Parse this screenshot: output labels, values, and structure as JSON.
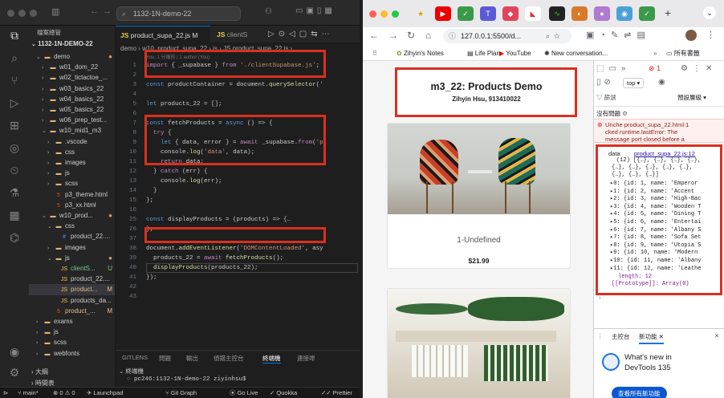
{
  "vscode": {
    "search": "1132-1N-demo-22",
    "explorer_title": "檔案總管",
    "explorer_root": "1132-1N-DEMO-22",
    "tree": [
      {
        "label": "demo",
        "icon": "folder",
        "open": true,
        "depth": 1,
        "status": "●"
      },
      {
        "label": "w01_dom_22",
        "icon": "folder",
        "open": false,
        "depth": 2,
        "status": ""
      },
      {
        "label": "w02_tictactoe_...",
        "icon": "folder",
        "open": false,
        "depth": 2,
        "status": ""
      },
      {
        "label": "w03_basics_22",
        "icon": "folder",
        "open": false,
        "depth": 2,
        "status": ""
      },
      {
        "label": "w04_basics_22",
        "icon": "folder",
        "open": false,
        "depth": 2,
        "status": ""
      },
      {
        "label": "w05_basics_22",
        "icon": "folder",
        "open": false,
        "depth": 2,
        "status": ""
      },
      {
        "label": "w06_prep_test...",
        "icon": "folder",
        "open": false,
        "depth": 2,
        "status": ""
      },
      {
        "label": "w10_mid1_m3",
        "icon": "folder",
        "open": true,
        "depth": 2,
        "status": ""
      },
      {
        "label": ".vscode",
        "icon": "folder",
        "open": false,
        "depth": 3,
        "status": ""
      },
      {
        "label": "css",
        "icon": "folder",
        "open": false,
        "depth": 3,
        "status": ""
      },
      {
        "label": "images",
        "icon": "folder",
        "open": false,
        "depth": 3,
        "status": ""
      },
      {
        "label": "js",
        "icon": "folder",
        "open": false,
        "depth": 3,
        "status": ""
      },
      {
        "label": "scss",
        "icon": "folder",
        "open": false,
        "depth": 3,
        "status": ""
      },
      {
        "label": "p3_theme.html",
        "icon": "html",
        "open": null,
        "depth": 3,
        "status": ""
      },
      {
        "label": "p3_xx.html",
        "icon": "html",
        "open": null,
        "depth": 3,
        "status": ""
      },
      {
        "label": "w10_prod...",
        "icon": "folder",
        "open": true,
        "depth": 2,
        "status": "●"
      },
      {
        "label": "css",
        "icon": "folder",
        "open": true,
        "depth": 3,
        "status": ""
      },
      {
        "label": "product_22....",
        "icon": "css",
        "open": null,
        "depth": 4,
        "status": ""
      },
      {
        "label": "images",
        "icon": "folder",
        "open": false,
        "depth": 3,
        "status": ""
      },
      {
        "label": "js",
        "icon": "folder",
        "open": true,
        "depth": 3,
        "status": "●"
      },
      {
        "label": "clientS...",
        "icon": "js",
        "open": null,
        "depth": 4,
        "status": "U"
      },
      {
        "label": "product_22....",
        "icon": "js",
        "open": null,
        "depth": 4,
        "status": ""
      },
      {
        "label": "product...",
        "icon": "js",
        "open": null,
        "depth": 4,
        "status": "M"
      },
      {
        "label": "products_da...",
        "icon": "js",
        "open": null,
        "depth": 4,
        "status": ""
      },
      {
        "label": "product_...",
        "icon": "html",
        "open": null,
        "depth": 3,
        "status": "M"
      },
      {
        "label": "exams",
        "icon": "folder",
        "open": false,
        "depth": 1,
        "status": ""
      },
      {
        "label": "js",
        "icon": "folder",
        "open": false,
        "depth": 1,
        "status": ""
      },
      {
        "label": "scss",
        "icon": "folder",
        "open": false,
        "depth": 1,
        "status": ""
      },
      {
        "label": "webfonts",
        "icon": "folder",
        "open": false,
        "depth": 1,
        "status": ""
      }
    ],
    "outline_label": "大綱",
    "timeline_label": "時間表",
    "tabs": [
      {
        "label": "product_supa_22.js M",
        "active": true
      },
      {
        "label": "clientS",
        "active": false
      }
    ],
    "breadcrumb": "demo › w10_product_supa_22 › js › JS product_supa_22.js › ...",
    "codelens": "You, 1 分鐘前 | 1 author (You)",
    "code": [
      {
        "n": "1",
        "t": "import { _supabase } from './clientSupabase.js';"
      },
      {
        "n": "2",
        "t": ""
      },
      {
        "n": "3",
        "t": "const productContainer = document.querySelector('"
      },
      {
        "n": "4",
        "t": ""
      },
      {
        "n": "5",
        "t": "let products_22 = [];"
      },
      {
        "n": "6",
        "t": ""
      },
      {
        "n": "7",
        "t": "const fetchProducts = async () => {"
      },
      {
        "n": "8",
        "t": "  try {"
      },
      {
        "n": "9",
        "t": "    let { data, error } = await _supabase.from('p"
      },
      {
        "n": "10",
        "t": "    console.log('data', data);"
      },
      {
        "n": "11",
        "t": "    return data;"
      },
      {
        "n": "12",
        "t": "  } catch (err) {"
      },
      {
        "n": "13",
        "t": "    console.log(err);"
      },
      {
        "n": "14",
        "t": "  }"
      },
      {
        "n": "15",
        "t": "};"
      },
      {
        "n": "16",
        "t": ""
      },
      {
        "n": "25",
        "t": "const displayProducts = (products) => {…"
      },
      {
        "n": "26",
        "t": "};"
      },
      {
        "n": "37",
        "t": ""
      },
      {
        "n": "38",
        "t": "document.addEventListener('DOMContentLoaded', asy"
      },
      {
        "n": "39",
        "t": "  products_22 = await fetchProducts();"
      },
      {
        "n": "40",
        "t": "  displayProducts(products_22);"
      },
      {
        "n": "41",
        "t": "});"
      },
      {
        "n": "42",
        "t": ""
      },
      {
        "n": "43",
        "t": ""
      }
    ],
    "panel_tabs": [
      "GITLENS",
      "問題",
      "輸出",
      "偵錯主控台",
      "終端機",
      "連接埠"
    ],
    "terminal_label": "終端機",
    "terminal_prompt": "pc246:1132-1N-demo-22 ziyinhsu$",
    "status": {
      "branch": "main*",
      "errors": "⊗ 0 ⚠ 0",
      "launchpad": "Launchpad",
      "git_graph": "Git Graph",
      "go_live": "Go Live",
      "quokka": "Quokka",
      "prettier": "Prettier"
    }
  },
  "chrome": {
    "url": "127.0.0.1:5500/d...",
    "bookmarks": [
      "Zihyin's Notes",
      "Life Plan",
      "YouTube",
      "New conversation...",
      "所有書籤"
    ],
    "page_title": "m3_22: Products Demo",
    "page_subtitle": "Zihyin Hsu, 913410022",
    "products": [
      {
        "name": "1-Undefined",
        "price": "$21.99"
      }
    ],
    "devtools": {
      "top": "top",
      "filter_placeholder": "篩選",
      "levels": "預設層級",
      "no_issues": "沒有問題",
      "error_lines": [
        "Unche product_supa_22.html:1",
        "cked runtime.lastError: The",
        "message port closed before a"
      ],
      "log_label": "data",
      "log_source": "product_supa_22.js:12",
      "array_summary": "(12) [{…}, {…}, {…}, {…},",
      "array_summary2": "{…}, {…}, {…}, {…}, {…},",
      "array_summary3": "{…}, {…}, {…}]",
      "items": [
        "0: {id: 1, name: 'Emperor",
        "1: {id: 2, name: 'Accent",
        "2: {id: 3, name: 'High-Bac",
        "3: {id: 4, name: 'Wooden T",
        "4: {id: 5, name: 'Dining T",
        "5: {id: 6, name: 'Entertai",
        "6: {id: 7, name: 'Albany S",
        "7: {id: 8, name: 'Sofa Set",
        "8: {id: 9, name: 'Utopia S",
        "9: {id: 10, name: 'Modern",
        "10: {id: 11, name: 'Albany",
        "11: {id: 12, name: 'Leathe"
      ],
      "length": "length: 12",
      "prototype": "[[Prototype]]: Array(0)",
      "drawer_tabs": [
        "主控台",
        "新功能"
      ],
      "whats_new": "What's new in",
      "whats_new2": "DevTools 135",
      "whats_new_btn": "查看所有新功能"
    }
  },
  "colors": {
    "highlight": "#d9301f",
    "vscode_bg": "#1e1e1e",
    "accent": "#1a73e8"
  }
}
